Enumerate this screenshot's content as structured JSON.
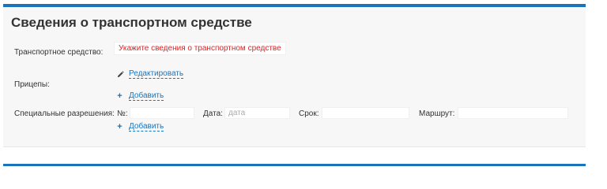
{
  "section": {
    "title": "Сведения о транспортном средстве"
  },
  "vehicle": {
    "label": "Транспортное средство:",
    "error": "Укажите сведения о транспортном средстве"
  },
  "trailers": {
    "label": "Прицепы:",
    "edit_label": "Редактировать",
    "add_label": "Добавить"
  },
  "permits": {
    "label": "Специальные разрешения:",
    "number_label": "№:",
    "number_value": "",
    "date_label": "Дата:",
    "date_placeholder": "дата",
    "term_label": "Срок:",
    "term_value": "",
    "route_label": "Маршрут:",
    "route_value": "",
    "add_label": "Добавить"
  },
  "colors": {
    "accent": "#1a74bb",
    "error": "#e02020",
    "panel_bg": "#f7f7f7"
  },
  "icons": [
    "pencil-icon",
    "plus-icon"
  ]
}
